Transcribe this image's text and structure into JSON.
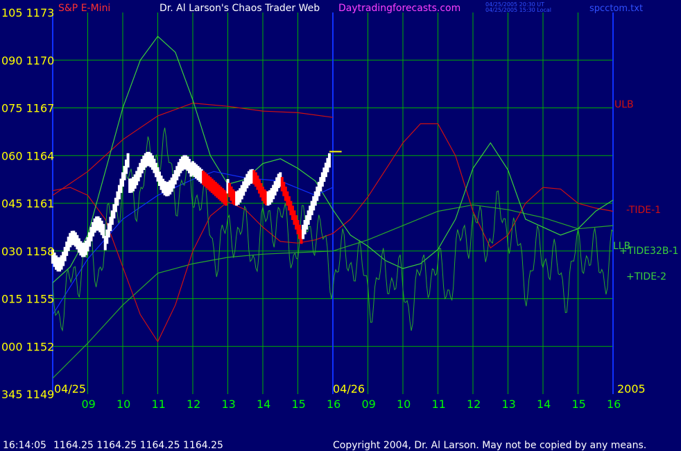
{
  "header": {
    "instrument": "S&P E-Mini",
    "title": "Dr. Al Larson's Chaos Trader Web",
    "site": "Daytradingforecasts.com",
    "stamp_line1": "04/25/2005 20:30 UT",
    "stamp_line2": "04/25/2005 15:30 Local",
    "file": "spcctom.txt"
  },
  "footer": {
    "time": "16:14:05",
    "quote": "1164.25 1164.25 1164.25 1164.25",
    "copyright": "Copyright 2004, Dr. Al Larson. May not be copied by any means."
  },
  "colors": {
    "background": "#00006b",
    "grid": "#00b000",
    "price": "#ffffff",
    "down": "#ff0000",
    "ulb": "#d01010",
    "tide": "#2aa82a",
    "tide32": "#3bd03b",
    "blue": "#1030ff",
    "yellow": "#ffff00",
    "axis_text": "#ffff00",
    "hour_text": "#00ff00"
  },
  "chart_data": {
    "type": "line",
    "y_ticks": [
      {
        "angle": "105",
        "price": "1173",
        "value": 1173
      },
      {
        "angle": "090",
        "price": "1170",
        "value": 1170
      },
      {
        "angle": "075",
        "price": "1167",
        "value": 1167
      },
      {
        "angle": "060",
        "price": "1164",
        "value": 1164
      },
      {
        "angle": "045",
        "price": "1161",
        "value": 1161
      },
      {
        "angle": "030",
        "price": "1158",
        "value": 1158
      },
      {
        "angle": "015",
        "price": "1155",
        "value": 1155
      },
      {
        "angle": "000",
        "price": "1152",
        "value": 1152
      },
      {
        "angle": "345",
        "price": "1149",
        "value": 1149
      }
    ],
    "ylim": [
      1149,
      1173
    ],
    "x_hours": [
      "09",
      "10",
      "11",
      "12",
      "13",
      "14",
      "15",
      "16",
      "09",
      "10",
      "11",
      "12",
      "13",
      "14",
      "15",
      "16"
    ],
    "date_labels": [
      "04/25",
      "04/26"
    ],
    "year_label": "2005",
    "xlim": [
      8,
      24
    ],
    "series_labels": [
      {
        "name": "ULB",
        "color": "#d01010"
      },
      {
        "name": "-TIDE-1",
        "color": "#d01010"
      },
      {
        "name": "LLB",
        "color": "#3bd03b"
      },
      {
        "name": "+TIDE32B-1",
        "color": "#3bd03b"
      },
      {
        "name": "+TIDE-2",
        "color": "#3bd03b"
      }
    ],
    "series": [
      {
        "key": "ULB",
        "color": "#d01010",
        "x": [
          8,
          9,
          10,
          11,
          12,
          13,
          14,
          15,
          16
        ],
        "y": [
          1161.5,
          1163,
          1165,
          1166.5,
          1167.3,
          1167.1,
          1166.8,
          1166.7,
          1166.4
        ]
      },
      {
        "key": "LLB",
        "color": "#2aa82a",
        "x": [
          8,
          9,
          10,
          11,
          12,
          13,
          14,
          15,
          16,
          17,
          18,
          19,
          20,
          21,
          22,
          23,
          24
        ],
        "y": [
          1150,
          1152.2,
          1154.6,
          1156.6,
          1157.2,
          1157.6,
          1157.8,
          1157.9,
          1158,
          1158.7,
          1159.6,
          1160.5,
          1160.9,
          1160.6,
          1160.1,
          1159.4,
          1159.6
        ]
      },
      {
        "key": "TIDE1",
        "color": "#d01010",
        "x": [
          8,
          8.5,
          9,
          9.5,
          10,
          10.5,
          11,
          11.5,
          12,
          12.5,
          13,
          13.5,
          14,
          14.5,
          15,
          15.5,
          16,
          16.5,
          17,
          17.5,
          18,
          18.5,
          19,
          19.5,
          20,
          20.5,
          21,
          21.5,
          22,
          22.5,
          23,
          23.5,
          24
        ],
        "y": [
          1161.8,
          1162,
          1161.5,
          1160,
          1157,
          1154,
          1152.3,
          1154.6,
          1158,
          1160.2,
          1161.1,
          1160.6,
          1159.5,
          1158.6,
          1158.5,
          1158.7,
          1159.1,
          1160,
          1161.4,
          1163.1,
          1164.8,
          1166,
          1166,
          1164,
          1160.5,
          1158.2,
          1159,
          1161,
          1162,
          1161.9,
          1161,
          1160.7,
          1160.5
        ]
      },
      {
        "key": "TIDE32",
        "color": "#3bd03b",
        "x": [
          8,
          8.5,
          9,
          9.5,
          10,
          10.5,
          11,
          11.5,
          12,
          12.5,
          13,
          13.5,
          14,
          14.5,
          15,
          15.5,
          16,
          16.5,
          17,
          17.5,
          18,
          18.5,
          19,
          19.5,
          20,
          20.5,
          21,
          21.5,
          22,
          22.5,
          23,
          23.5,
          24
        ],
        "y": [
          1156,
          1157,
          1159,
          1163,
          1167,
          1170,
          1171.5,
          1170.5,
          1167.5,
          1164,
          1162.2,
          1162.5,
          1163.5,
          1163.8,
          1163.2,
          1162.4,
          1160.6,
          1159,
          1158.3,
          1157.4,
          1156.9,
          1157.2,
          1158.1,
          1160,
          1163.2,
          1164.8,
          1163.1,
          1160,
          1159.5,
          1159,
          1159.4,
          1160.5,
          1161.2
        ]
      },
      {
        "key": "BLUE",
        "color": "#1030ff",
        "x": [
          8,
          9,
          10,
          11,
          12,
          12.6,
          13.5,
          14.5,
          15.5,
          16
        ],
        "y": [
          1154,
          1157.5,
          1160,
          1161.5,
          1162.5,
          1163,
          1162.6,
          1162.4,
          1161.5,
          1162
        ]
      }
    ]
  }
}
